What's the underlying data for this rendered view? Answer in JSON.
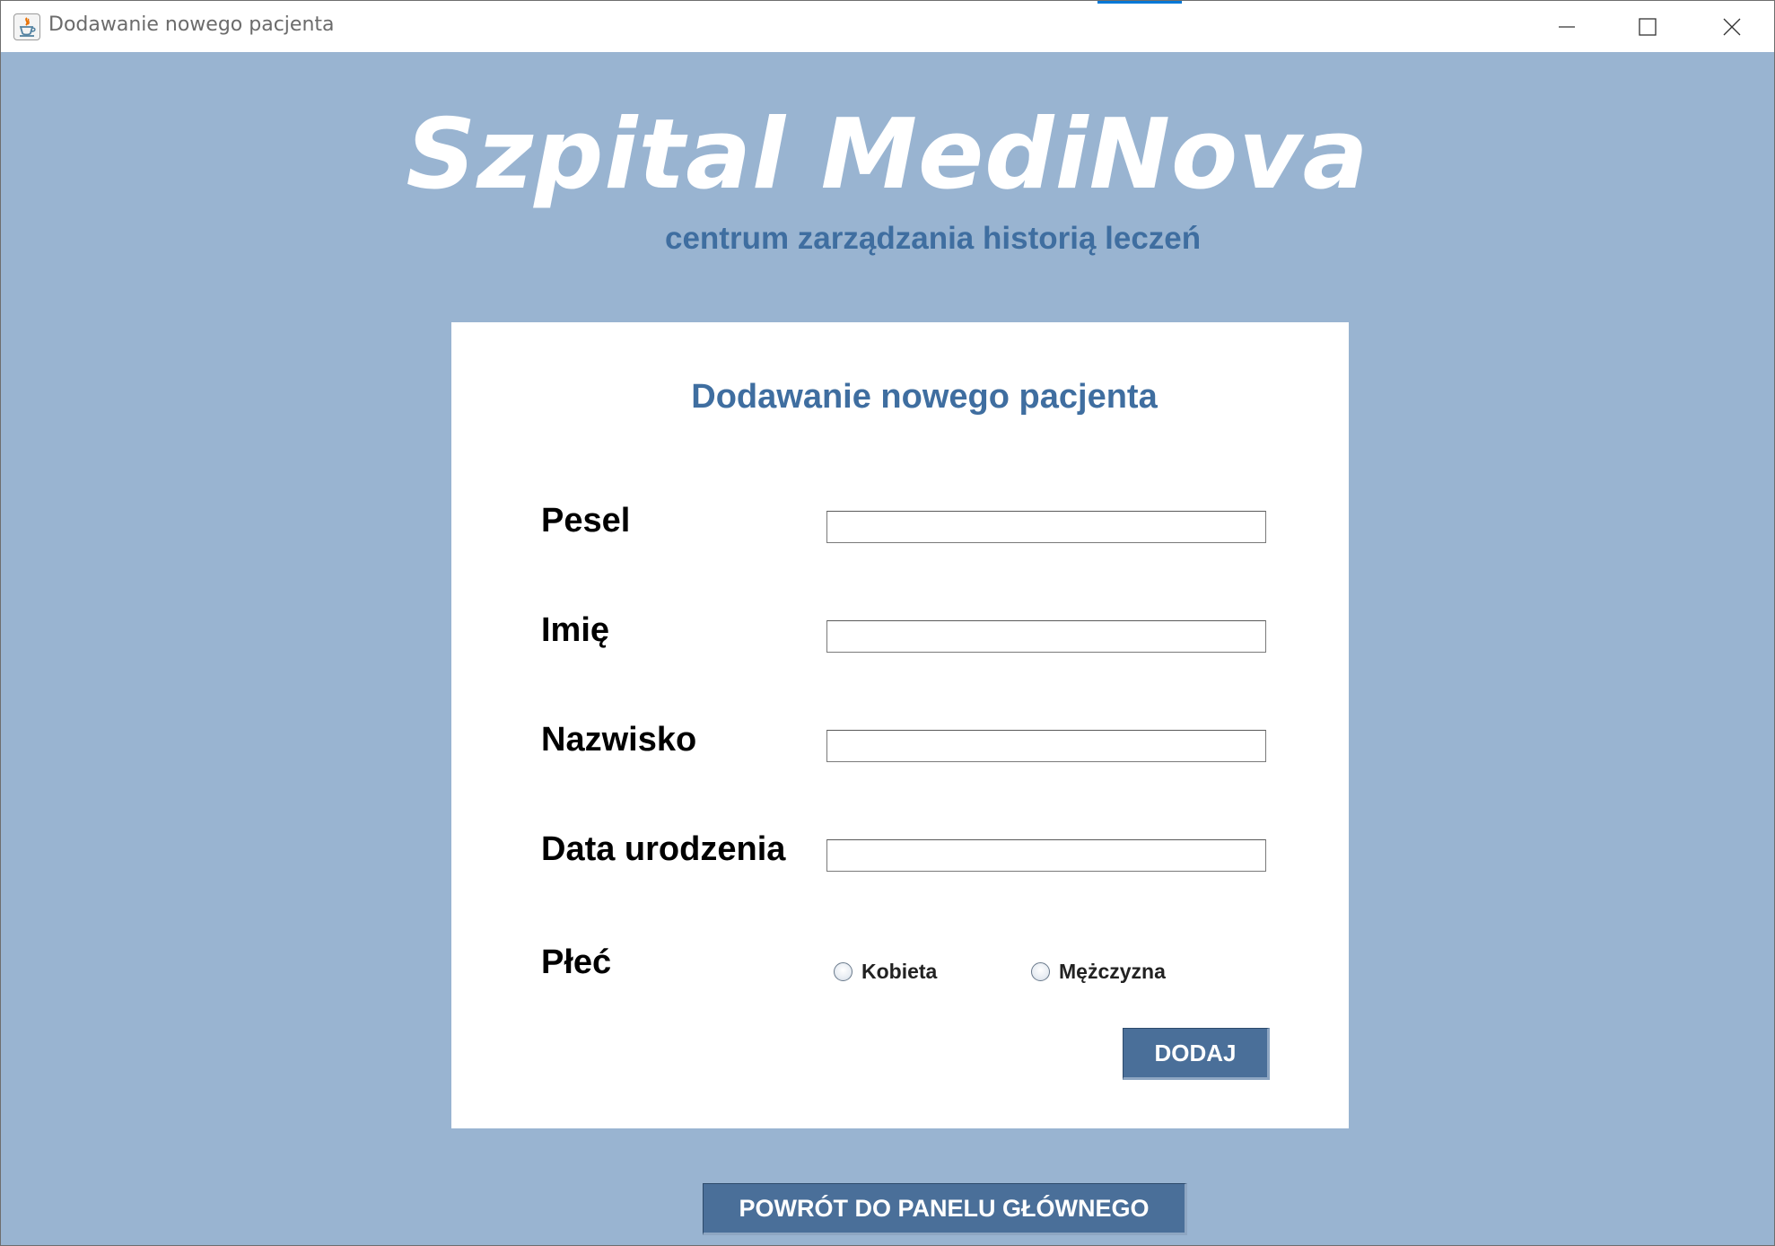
{
  "window": {
    "title": "Dodawanie nowego pacjenta",
    "icons": {
      "app": "java-cup-icon",
      "minimize": "minimize-icon",
      "maximize": "maximize-icon",
      "close": "close-icon"
    }
  },
  "brand": {
    "name": "Szpital MediNova",
    "subtitle": "centrum zarządzania historią leczeń"
  },
  "form": {
    "title": "Dodawanie nowego pacjenta",
    "fields": [
      {
        "label": "Pesel",
        "value": ""
      },
      {
        "label": "Imię",
        "value": ""
      },
      {
        "label": "Nazwisko",
        "value": ""
      },
      {
        "label": "Data urodzenia",
        "value": ""
      }
    ],
    "gender": {
      "label": "Płeć",
      "options": [
        "Kobieta",
        "Mężczyzna"
      ],
      "selected": null
    },
    "submit_label": "DODAJ"
  },
  "footer": {
    "back_label": "POWRÓT DO PANELU GŁÓWNEGO"
  },
  "colors": {
    "background": "#99b4d1",
    "accent": "#3f6ea0",
    "button": "#4a6f99",
    "panel": "#ffffff"
  }
}
